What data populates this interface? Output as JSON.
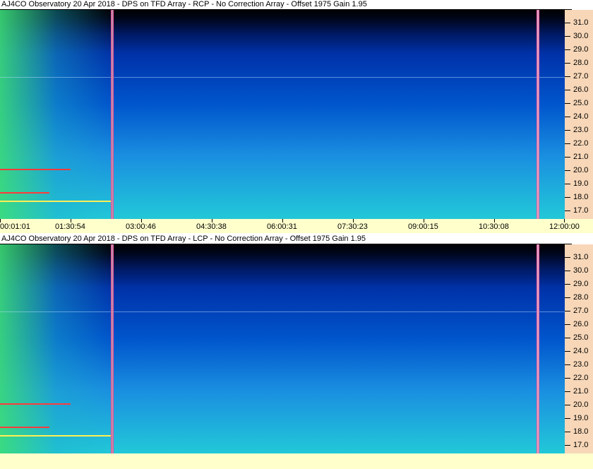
{
  "panels": [
    {
      "title": "AJ4CO Observatory 20 Apr 2018 - DPS on TFD Array  - RCP  -  No Correction Array  -  Offset 1975  Gain 1.95"
    },
    {
      "title": "AJ4CO Observatory 20 Apr 2018 - DPS on TFD Array  - LCP  -  No Correction Array  -  Offset 1975  Gain 1.95"
    }
  ],
  "freq_labels": [
    "31.0",
    "30.0",
    "29.0",
    "28.0",
    "27.0",
    "26.0",
    "25.0",
    "24.0",
    "23.0",
    "22.0",
    "21.0",
    "20.0",
    "19.0",
    "18.0",
    "17.0"
  ],
  "time_labels": [
    "00:01:01",
    "01:30:54",
    "03:00:46",
    "04:30:38",
    "06:00:31",
    "07:30:23",
    "09:00:15",
    "10:30:08",
    "12:00:00"
  ],
  "colors": {
    "freq_axis_bg": "#f7d7b8",
    "time_axis_bg": "#ffffcc",
    "marker_line": "#ff3399"
  }
}
